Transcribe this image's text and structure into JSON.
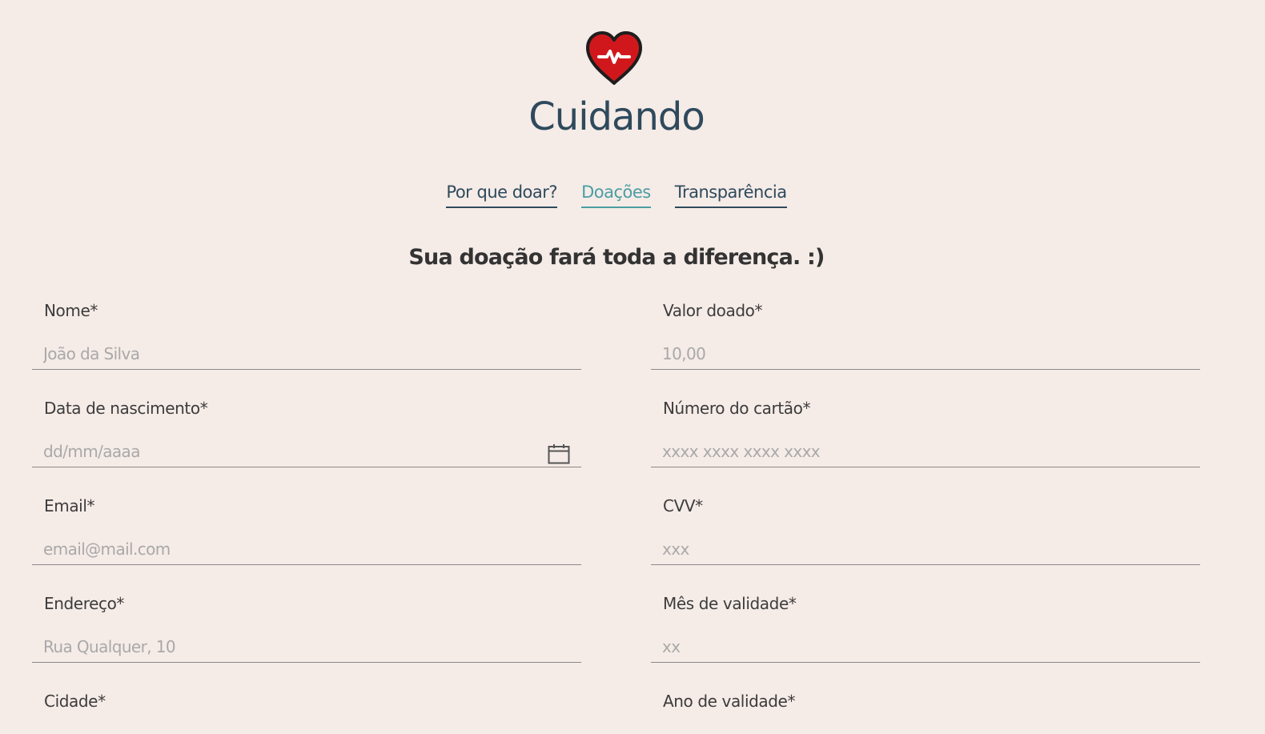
{
  "header": {
    "logo_icon": "heart-pulse-icon",
    "title": "Cuidando"
  },
  "nav": {
    "items": [
      {
        "label": "Por que doar?",
        "active": false
      },
      {
        "label": "Doações",
        "active": true
      },
      {
        "label": "Transparência",
        "active": false
      }
    ]
  },
  "subtitle": "Sua doação fará toda a diferença. :)",
  "form": {
    "nome": {
      "label": "Nome*",
      "placeholder": "João da Silva",
      "value": ""
    },
    "data_nascimento": {
      "label": "Data de nascimento*",
      "placeholder": "dd/mm/aaaa",
      "value": ""
    },
    "email": {
      "label": "Email*",
      "placeholder": "email@mail.com",
      "value": ""
    },
    "endereco": {
      "label": "Endereço*",
      "placeholder": "Rua Qualquer, 10",
      "value": ""
    },
    "cidade": {
      "label": "Cidade*"
    },
    "valor": {
      "label": "Valor doado*",
      "placeholder": "10,00",
      "value": ""
    },
    "numero_cartao": {
      "label": "Número do cartão*",
      "placeholder": "xxxx xxxx xxxx xxxx",
      "value": ""
    },
    "cvv": {
      "label": "CVV*",
      "placeholder": "xxx",
      "value": ""
    },
    "mes_validade": {
      "label": "Mês de validade*",
      "placeholder": "xx",
      "value": ""
    },
    "ano_validade": {
      "label": "Ano de validade*"
    }
  },
  "colors": {
    "background": "#f5ebe7",
    "title": "#2e4a5c",
    "nav_active": "#4a9ea3",
    "heart": "#d0181c"
  }
}
